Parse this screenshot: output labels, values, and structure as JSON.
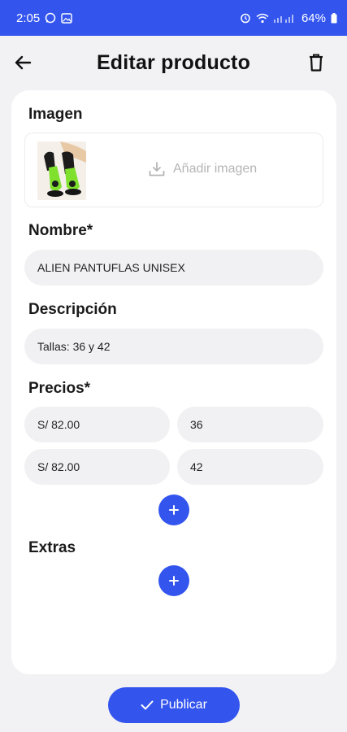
{
  "status_bar": {
    "time": "2:05",
    "battery": "64%"
  },
  "header": {
    "title": "Editar producto"
  },
  "image_section": {
    "label": "Imagen",
    "add_label": "Añadir imagen"
  },
  "name_section": {
    "label": "Nombre*",
    "value": "ALIEN PANTUFLAS UNISEX"
  },
  "description_section": {
    "label": "Descripción",
    "value": "Tallas: 36 y 42"
  },
  "prices_section": {
    "label": "Precios*",
    "rows": [
      {
        "price": "S/  82.00",
        "variant": "36"
      },
      {
        "price": "S/  82.00",
        "variant": "42"
      }
    ]
  },
  "extras_section": {
    "label": "Extras"
  },
  "publish_button": {
    "label": "Publicar"
  },
  "colors": {
    "accent": "#3355ee"
  }
}
